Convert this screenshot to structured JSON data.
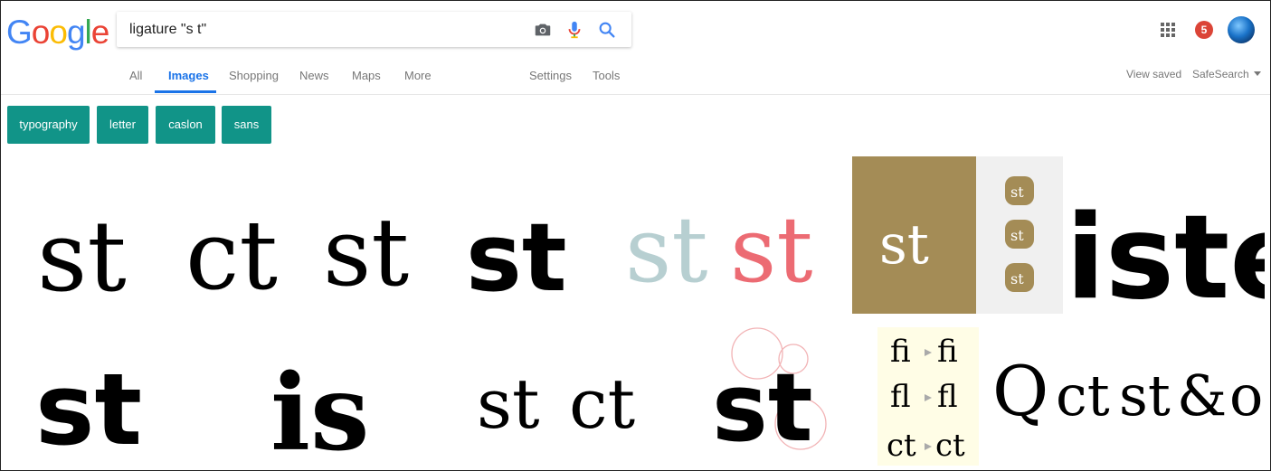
{
  "logo": {
    "letters": [
      "G",
      "o",
      "o",
      "g",
      "l",
      "e"
    ],
    "colors": [
      "#4285f4",
      "#ea4335",
      "#fbbc05",
      "#4285f4",
      "#34a853",
      "#ea4335"
    ]
  },
  "search": {
    "query": "ligature \"s t\""
  },
  "notifications": {
    "count": "5"
  },
  "tabs": {
    "all": "All",
    "images": "Images",
    "shopping": "Shopping",
    "news": "News",
    "maps": "Maps",
    "more": "More",
    "settings": "Settings",
    "tools": "Tools",
    "view_saved": "View saved",
    "safesearch": "SafeSearch"
  },
  "chips": [
    "typography",
    "letter",
    "caslon",
    "sans"
  ],
  "results": {
    "r1": "st",
    "r2": "ct",
    "r3": "st",
    "r4": "st",
    "r5a": "st",
    "r5b": "st",
    "r6": "st",
    "r6_small": [
      "st",
      "st",
      "st"
    ],
    "r7": "iste",
    "r8": "st",
    "r9": "is",
    "r10a": "st",
    "r10b": "ct",
    "r11": "st",
    "r12": [
      [
        "fi",
        "fi"
      ],
      [
        "fl",
        "fl"
      ],
      [
        "ct",
        "ct"
      ]
    ],
    "r13": [
      "Q",
      "ct",
      "st",
      "&",
      "o"
    ]
  },
  "colors": {
    "accent": "#1a73e8",
    "chip": "#119488",
    "badge": "#db4437",
    "gold": "#a48c56",
    "light_teal": "#b7cfd1",
    "pink": "#ec6b73"
  },
  "icons": [
    "camera-icon",
    "microphone-icon",
    "search-icon",
    "apps-grid-icon",
    "caret-down-icon"
  ]
}
